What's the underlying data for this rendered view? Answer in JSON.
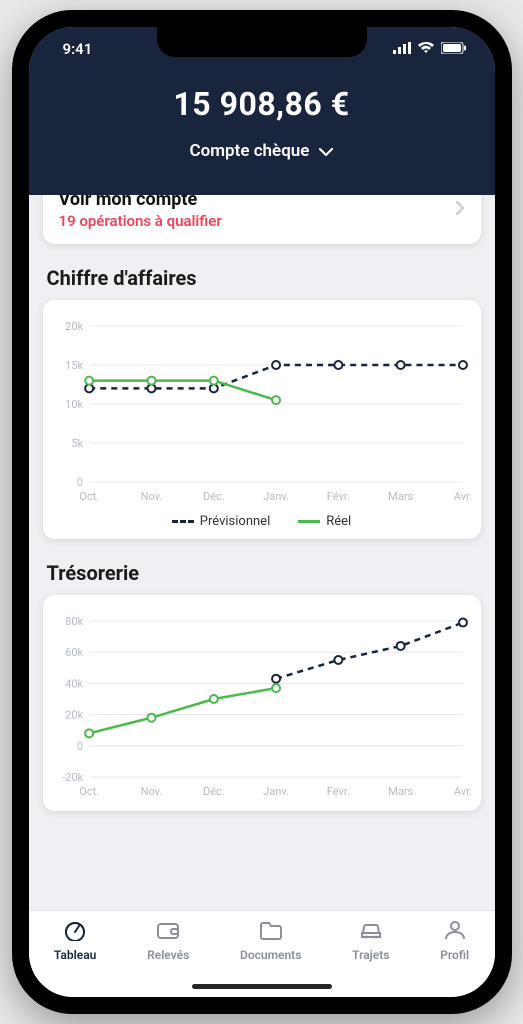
{
  "status": {
    "time": "9:41"
  },
  "header": {
    "balance": "15 908,86 €",
    "account_label": "Compte chèque"
  },
  "account_card": {
    "title": "Voir mon compte",
    "subtitle": "19 opérations à qualifier"
  },
  "sections": {
    "revenue_title": "Chiffre d'affaires",
    "treasury_title": "Trésorerie"
  },
  "legend": {
    "previsionnel": "Prévisionnel",
    "reel": "Réel"
  },
  "tabs": {
    "tableau": "Tableau",
    "releves": "Relevés",
    "documents": "Documents",
    "trajets": "Trajets",
    "profil": "Profil"
  },
  "chart_data": [
    {
      "id": "revenue",
      "type": "line",
      "title": "Chiffre d'affaires",
      "xlabel": "",
      "ylabel": "",
      "categories": [
        "Oct.",
        "Nov.",
        "Déc.",
        "Janv.",
        "Févr.",
        "Mars",
        "Avr."
      ],
      "y_ticks": [
        0,
        "5k",
        "10k",
        "15k",
        "20k"
      ],
      "ylim": [
        0,
        20000
      ],
      "series": [
        {
          "name": "Prévisionnel",
          "style": "dashed",
          "color": "#18253d",
          "values": [
            12000,
            12000,
            12000,
            15000,
            15000,
            15000,
            15000
          ]
        },
        {
          "name": "Réel",
          "style": "solid",
          "color": "#4bb94b",
          "values": [
            13000,
            13000,
            13000,
            10500,
            null,
            null,
            null
          ]
        }
      ]
    },
    {
      "id": "treasury",
      "type": "line",
      "title": "Trésorerie",
      "xlabel": "",
      "ylabel": "",
      "categories": [
        "Oct.",
        "Nov.",
        "Déc.",
        "Janv.",
        "Févr.",
        "Mars",
        "Avr."
      ],
      "y_ticks": [
        "-20k",
        "0",
        "20k",
        "40k",
        "60k",
        "80k"
      ],
      "ylim": [
        -20000,
        80000
      ],
      "series": [
        {
          "name": "Prévisionnel",
          "style": "dashed",
          "color": "#18253d",
          "values": [
            null,
            null,
            null,
            43000,
            55000,
            64000,
            79000
          ]
        },
        {
          "name": "Réel",
          "style": "solid",
          "color": "#4bb94b",
          "values": [
            8000,
            18000,
            30000,
            37000,
            null,
            null,
            null
          ]
        }
      ]
    }
  ]
}
